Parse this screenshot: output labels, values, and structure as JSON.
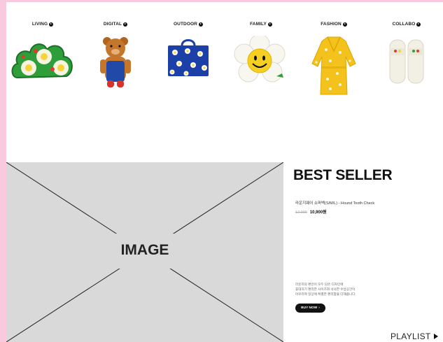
{
  "categories": [
    {
      "label": "LIVING"
    },
    {
      "label": "DIGITAL"
    },
    {
      "label": "OUTDOOR"
    },
    {
      "label": "FAMILY"
    },
    {
      "label": "FASHION"
    },
    {
      "label": "COLLABO"
    }
  ],
  "hero": {
    "placeholder_label": "IMAGE"
  },
  "best_seller": {
    "title": "BEST SELLER",
    "product_name": "라운지웨어 쇼퍼백(S/M/L) - Hound Tooth Check",
    "price_original": "12,000",
    "price_sale": "10,900원",
    "description": [
      "라운지의 편안이 모두 담은 디자인에",
      "휴대하기 편리한 사이즈와 넉넉한 수납공간이",
      "어우러져 일상에 특별한 편리함을 더해줍니다."
    ],
    "buy_button_label": "BUY NOW"
  },
  "playlist": {
    "label": "PLAYLIST"
  },
  "colors": {
    "frame_background": "#f8c9df",
    "placeholder_gray": "#d9d9d9",
    "button_black": "#111111"
  }
}
